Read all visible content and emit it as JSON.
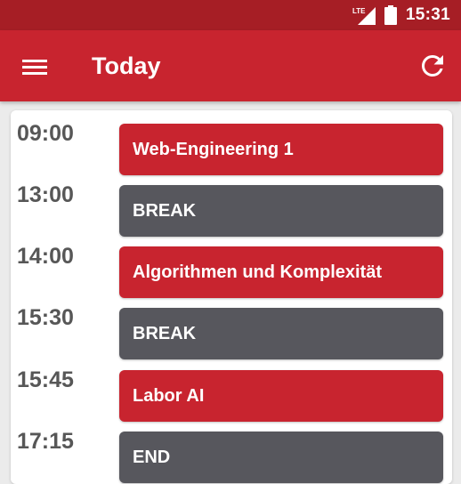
{
  "status_bar": {
    "network_label": "LTE",
    "clock": "15:31",
    "icons": [
      "signal-icon",
      "battery-icon"
    ]
  },
  "app_bar": {
    "title": "Today",
    "menu_icon": "hamburger-menu-icon",
    "refresh_icon": "refresh-icon"
  },
  "colors": {
    "status_bar": "#a61e25",
    "app_bar": "#c8242f",
    "lecture": "#c8242f",
    "break": "#57575d",
    "time_text": "#575757"
  },
  "schedule": [
    {
      "time": "09:00",
      "label": "Web-Engineering 1",
      "kind": "lecture"
    },
    {
      "time": "13:00",
      "label": "BREAK",
      "kind": "break"
    },
    {
      "time": "14:00",
      "label": "Algorithmen und Komplexität",
      "kind": "lecture"
    },
    {
      "time": "15:30",
      "label": "BREAK",
      "kind": "break"
    },
    {
      "time": "15:45",
      "label": "Labor AI",
      "kind": "lecture"
    },
    {
      "time": "17:15",
      "label": "END",
      "kind": "break"
    }
  ]
}
